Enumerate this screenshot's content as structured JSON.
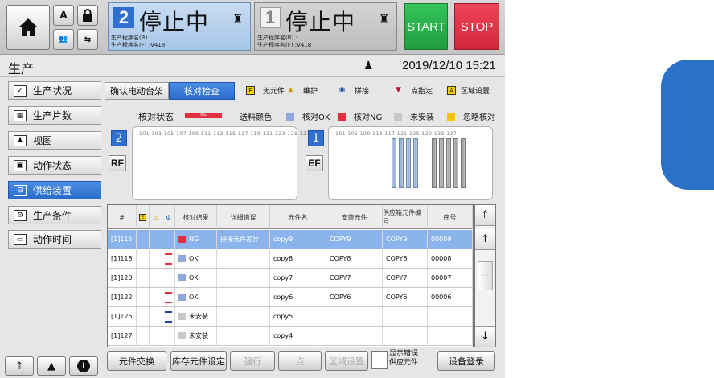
{
  "header": {
    "status1": {
      "num": "2",
      "text": "停止中",
      "prog_r": "生产程序名(R) :",
      "prog_f": "生产程序名(F) :V418"
    },
    "status2": {
      "num": "1",
      "text": "停止中",
      "prog_r": "生产程序名(R) :",
      "prog_f": "生产程序名(F) :V418"
    },
    "start_label": "START",
    "stop_label": "STOP"
  },
  "titlebar": {
    "title": "生产",
    "datetime": "2019/12/10 15:21"
  },
  "sidebar": {
    "items": [
      {
        "label": "生产状况",
        "icon": "checkbox-icon"
      },
      {
        "label": "生产片数",
        "icon": "counter-icon"
      },
      {
        "label": "视图",
        "icon": "person-icon"
      },
      {
        "label": "动作状态",
        "icon": "status-icon"
      },
      {
        "label": "供给装置",
        "icon": "feeder-icon"
      },
      {
        "label": "生产条件",
        "icon": "gear-icon"
      },
      {
        "label": "动作时间",
        "icon": "monitor-icon"
      }
    ]
  },
  "tabs": {
    "confirm": "确认电动台架",
    "check": "核对检查"
  },
  "legend_top": {
    "no_part_mark": "E",
    "no_part": "无元件",
    "maint": "维护",
    "splice": "拼接",
    "point": "点指定",
    "area_mark": "A",
    "area": "区域设置"
  },
  "legend2": {
    "verify_state": "核对状态",
    "bar_text": "NG",
    "feed_color": "送料颜色",
    "ok": "核对OK",
    "ng": "核对NG",
    "uninstalled": "未安装",
    "ignore": "忽略核对"
  },
  "colors": {
    "ok": "#8fa8dc",
    "ng": "#e23040",
    "uninstalled": "#c8c8c8",
    "ignore": "#f5c400",
    "accent": "#2f6fd0"
  },
  "feeders": {
    "left_badge": "2",
    "left_side": "RF",
    "left_numbers": "101 103 105 107 109 111 113 115 117 119 121 123 125 127",
    "right_badge": "1",
    "right_side": "EF",
    "right_numbers": "101  105  109  113  117  121  125  129  133  137"
  },
  "table": {
    "headers": {
      "num": "#",
      "e": "E",
      "maint": "⚠",
      "splice": "⚙",
      "check_result": "核对结果",
      "detail": "详细错误",
      "part": "元件名",
      "install": "安装元件",
      "feeder_id": "供应箱元件编号",
      "serial": "序号"
    },
    "rows": [
      {
        "num": "[1]115",
        "result": "NG",
        "detail": "拼接元件差异",
        "part": "copy9",
        "install": "COPY9",
        "feeder_id": "COPY9",
        "serial": "00009"
      },
      {
        "num": "[1]118",
        "result": "OK",
        "detail": "",
        "part": "copy8",
        "install": "COPY8",
        "feeder_id": "COPY8",
        "serial": "00008"
      },
      {
        "num": "[1]120",
        "result": "OK",
        "detail": "",
        "part": "copy7",
        "install": "COPY7",
        "feeder_id": "COPY7",
        "serial": "00007"
      },
      {
        "num": "[1]122",
        "result": "OK",
        "detail": "",
        "part": "copy6",
        "install": "COPY6",
        "feeder_id": "COPY6",
        "serial": "00006"
      },
      {
        "num": "[1]125",
        "result": "未安装",
        "detail": "",
        "part": "copy5",
        "install": "",
        "feeder_id": "",
        "serial": ""
      },
      {
        "num": "[1]127",
        "result": "未安装",
        "detail": "",
        "part": "copy4",
        "install": "",
        "feeder_id": "",
        "serial": ""
      }
    ]
  },
  "bottom": {
    "swap": "元件交换",
    "stock": "库存元件设定",
    "force": "强行",
    "point": "点",
    "area": "区域设置",
    "show_err": "显示错误",
    "show_err2": "供应元件",
    "register": "设备登录"
  }
}
